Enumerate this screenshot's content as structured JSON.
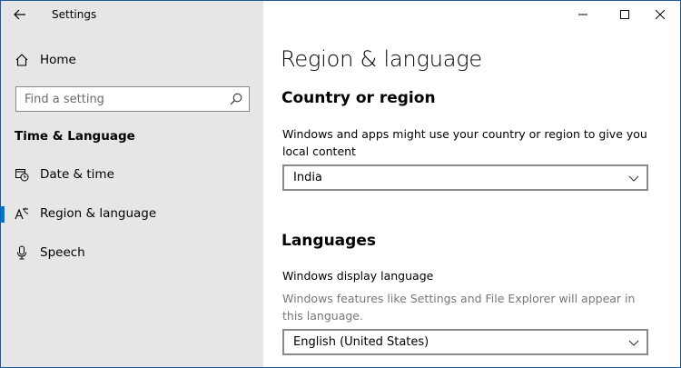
{
  "window": {
    "title": "Settings"
  },
  "sidebar": {
    "home_label": "Home",
    "search": {
      "placeholder": "Find a setting",
      "value": ""
    },
    "section_header": "Time & Language",
    "items": [
      {
        "label": "Date & time",
        "icon": "calendar-clock-icon",
        "active": false
      },
      {
        "label": "Region & language",
        "icon": "language-icon",
        "active": true
      },
      {
        "label": "Speech",
        "icon": "microphone-icon",
        "active": false
      }
    ]
  },
  "main": {
    "title": "Region & language",
    "country": {
      "heading": "Country or region",
      "description": "Windows and apps might use your country or region to give you local content",
      "selected": "India"
    },
    "languages": {
      "heading": "Languages",
      "display_language_label": "Windows display language",
      "display_language_description": "Windows features like Settings and File Explorer will appear in this language.",
      "selected": "English (United States)"
    }
  },
  "colors": {
    "accent": "#0078d7",
    "sidebar_bg": "#e6e6e6",
    "border": "#1e5a99"
  }
}
